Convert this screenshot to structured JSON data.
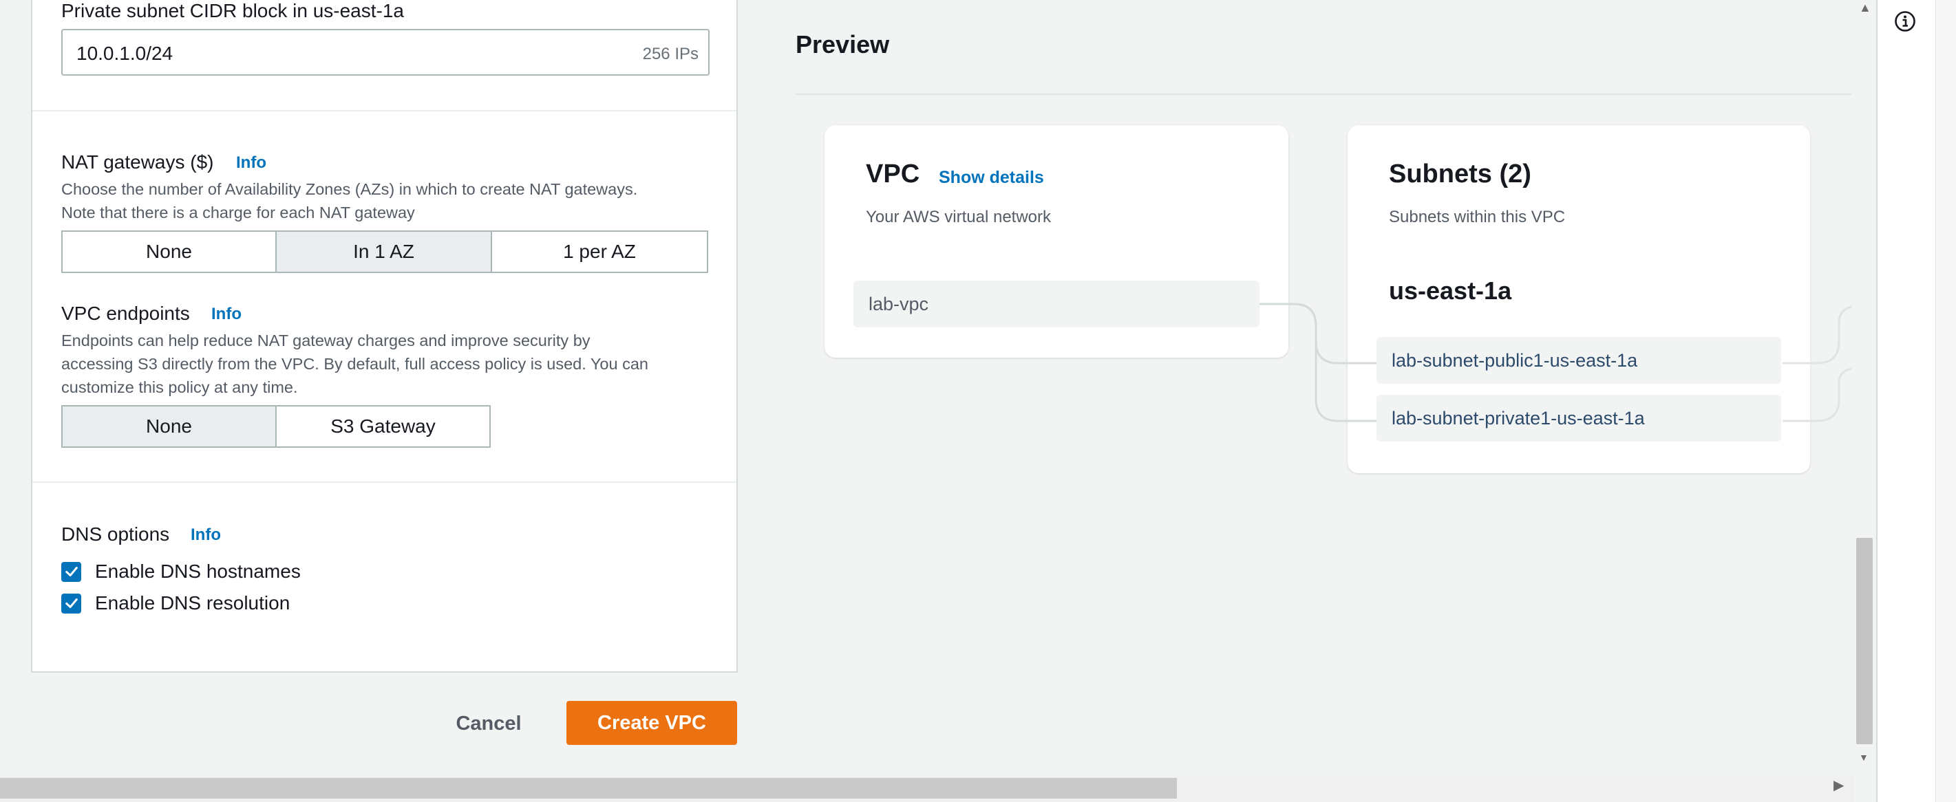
{
  "form": {
    "private_subnet": {
      "label": "Private subnet CIDR block in us-east-1a",
      "value": "10.0.1.0/24",
      "suffix": "256 IPs"
    },
    "nat": {
      "label": "NAT gateways ($)",
      "info": "Info",
      "desc_line1": "Choose the number of Availability Zones (AZs) in which to create NAT gateways.",
      "desc_line2": "Note that there is a charge for each NAT gateway",
      "options": [
        "None",
        "In 1 AZ",
        "1 per AZ"
      ],
      "selected": "In 1 AZ"
    },
    "endpoints": {
      "label": "VPC endpoints",
      "info": "Info",
      "desc_line1": "Endpoints can help reduce NAT gateway charges and improve security by",
      "desc_line2": "accessing S3 directly from the VPC. By default, full access policy is used. You can",
      "desc_line3": "customize this policy at any time.",
      "options": [
        "None",
        "S3 Gateway"
      ],
      "selected": "None"
    },
    "dns": {
      "label": "DNS options",
      "info": "Info",
      "hostnames_label": "Enable DNS hostnames",
      "resolution_label": "Enable DNS resolution",
      "hostnames_checked": true,
      "resolution_checked": true
    }
  },
  "actions": {
    "cancel_label": "Cancel",
    "create_label": "Create VPC"
  },
  "preview": {
    "title": "Preview",
    "vpc": {
      "heading": "VPC",
      "link": "Show details",
      "subtitle": "Your AWS virtual network",
      "name": "lab-vpc"
    },
    "subnets": {
      "heading": "Subnets (2)",
      "subtitle": "Subnets within this VPC",
      "az": "us-east-1a",
      "items": [
        "lab-subnet-public1-us-east-1a",
        "lab-subnet-private1-us-east-1a"
      ]
    }
  },
  "colors": {
    "accent": "#0073bb",
    "primary_button": "#ec7211",
    "page_bg": "#f2f3f3"
  },
  "icons": {
    "checkbox": "check-icon",
    "help": "info-circle-icon"
  }
}
